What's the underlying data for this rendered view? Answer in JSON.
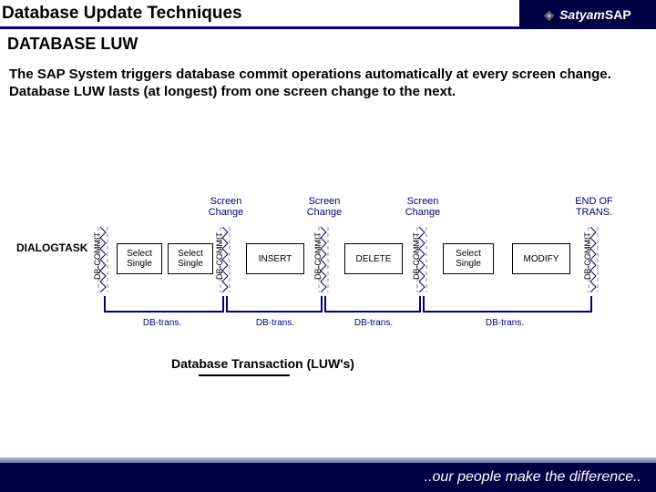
{
  "header": {
    "title": "Database Update Techniques",
    "brand": "Satyam",
    "brand_suffix": "SAP"
  },
  "subhead": "DATABASE LUW",
  "body": "The SAP System triggers database commit operations automatically at every screen change. Database LUW lasts (at longest) from one  screen change to the next.",
  "diagram": {
    "dialogtask": "DIALOGTASK",
    "db_commit_label": "DB-COMMIT",
    "top_labels": [
      "Screen Change",
      "Screen Change",
      "Screen Change",
      "END OF TRANS."
    ],
    "boxes": [
      "Select Single",
      "Select Single",
      "INSERT",
      "DELETE",
      "Select Single",
      "MODIFY"
    ],
    "db_trans_label": "DB-trans.",
    "caption": "Database Transaction (LUW's)"
  },
  "footer": {
    "tagline": "..our people make the difference.."
  },
  "chart_data": {
    "type": "table",
    "description": "Timeline of a SAP dialog task across screen changes, each segment bounded by DB-COMMIT and constituting one DB transaction (LUW).",
    "segments": [
      {
        "operations": [
          "Select Single",
          "Select Single"
        ],
        "boundary_after": "Screen Change"
      },
      {
        "operations": [
          "INSERT"
        ],
        "boundary_after": "Screen Change"
      },
      {
        "operations": [
          "DELETE"
        ],
        "boundary_after": "Screen Change"
      },
      {
        "operations": [
          "Select Single",
          "MODIFY"
        ],
        "boundary_after": "END OF TRANS."
      }
    ],
    "commit_markers": 5,
    "luw_count": 4
  }
}
